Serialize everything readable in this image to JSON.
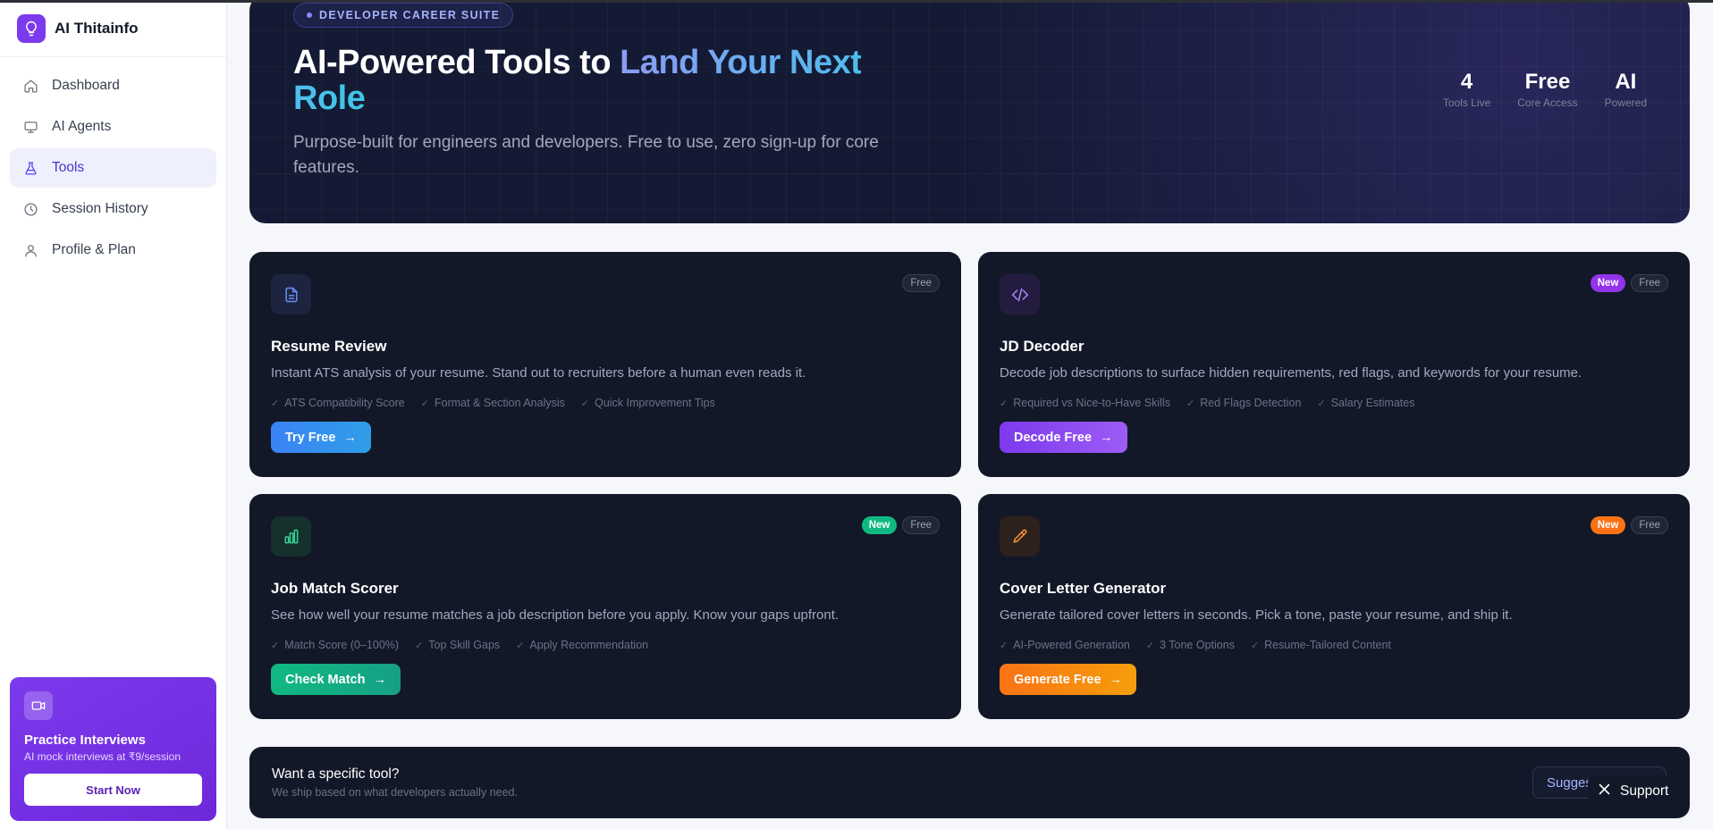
{
  "app": {
    "name": "AI Thitainfo",
    "logo_icon": "lightbulb-icon"
  },
  "sidebar": {
    "items": [
      {
        "label": "Dashboard",
        "icon": "home-icon",
        "active": false
      },
      {
        "label": "AI Agents",
        "icon": "monitor-icon",
        "active": false
      },
      {
        "label": "Tools",
        "icon": "flask-icon",
        "active": true
      },
      {
        "label": "Session History",
        "icon": "clock-icon",
        "active": false
      },
      {
        "label": "Profile & Plan",
        "icon": "user-icon",
        "active": false
      }
    ],
    "promo": {
      "icon": "video-camera-icon",
      "title": "Practice Interviews",
      "subtitle": "AI mock interviews at ₹9/session",
      "button": "Start Now"
    }
  },
  "hero": {
    "pill": "DEVELOPER CAREER SUITE",
    "title_plain": "AI-Powered Tools to ",
    "title_highlight": "Land Your Next Role",
    "subtitle": "Purpose-built for engineers and developers. Free to use, zero sign-up for core features.",
    "stats": [
      {
        "value": "4",
        "label": "Tools Live"
      },
      {
        "value": "Free",
        "label": "Core Access"
      },
      {
        "value": "AI",
        "label": "Powered"
      }
    ]
  },
  "tools": [
    {
      "title": "Resume Review",
      "icon": "document-icon",
      "description": "Instant ATS analysis of your resume. Stand out to recruiters before a human even reads it.",
      "badges": [
        "Free"
      ],
      "features": [
        "ATS Compatibility Score",
        "Format & Section Analysis",
        "Quick Improvement Tips"
      ],
      "cta": "Try Free",
      "accent": "#3b82f6"
    },
    {
      "title": "JD Decoder",
      "icon": "code-icon",
      "description": "Decode job descriptions to surface hidden requirements, red flags, and keywords for your resume.",
      "badges": [
        "New",
        "Free"
      ],
      "features": [
        "Required vs Nice-to-Have Skills",
        "Red Flags Detection",
        "Salary Estimates"
      ],
      "cta": "Decode Free",
      "accent": "#8b5cf6"
    },
    {
      "title": "Job Match Scorer",
      "icon": "bar-chart-icon",
      "description": "See how well your resume matches a job description before you apply. Know your gaps upfront.",
      "badges": [
        "New",
        "Free"
      ],
      "features": [
        "Match Score (0–100%)",
        "Top Skill Gaps",
        "Apply Recommendation"
      ],
      "cta": "Check Match",
      "accent": "#10b981"
    },
    {
      "title": "Cover Letter Generator",
      "icon": "pencil-icon",
      "description": "Generate tailored cover letters in seconds. Pick a tone, paste your resume, and ship it.",
      "badges": [
        "New",
        "Free"
      ],
      "features": [
        "AI-Powered Generation",
        "3 Tone Options",
        "Resume-Tailored Content"
      ],
      "cta": "Generate Free",
      "accent": "#f97316"
    }
  ],
  "request": {
    "title": "Want a specific tool?",
    "subtitle": "We ship based on what developers actually need.",
    "button": "Suggest a Tool"
  },
  "support": {
    "label": "Support",
    "icon": "x-close-icon"
  }
}
